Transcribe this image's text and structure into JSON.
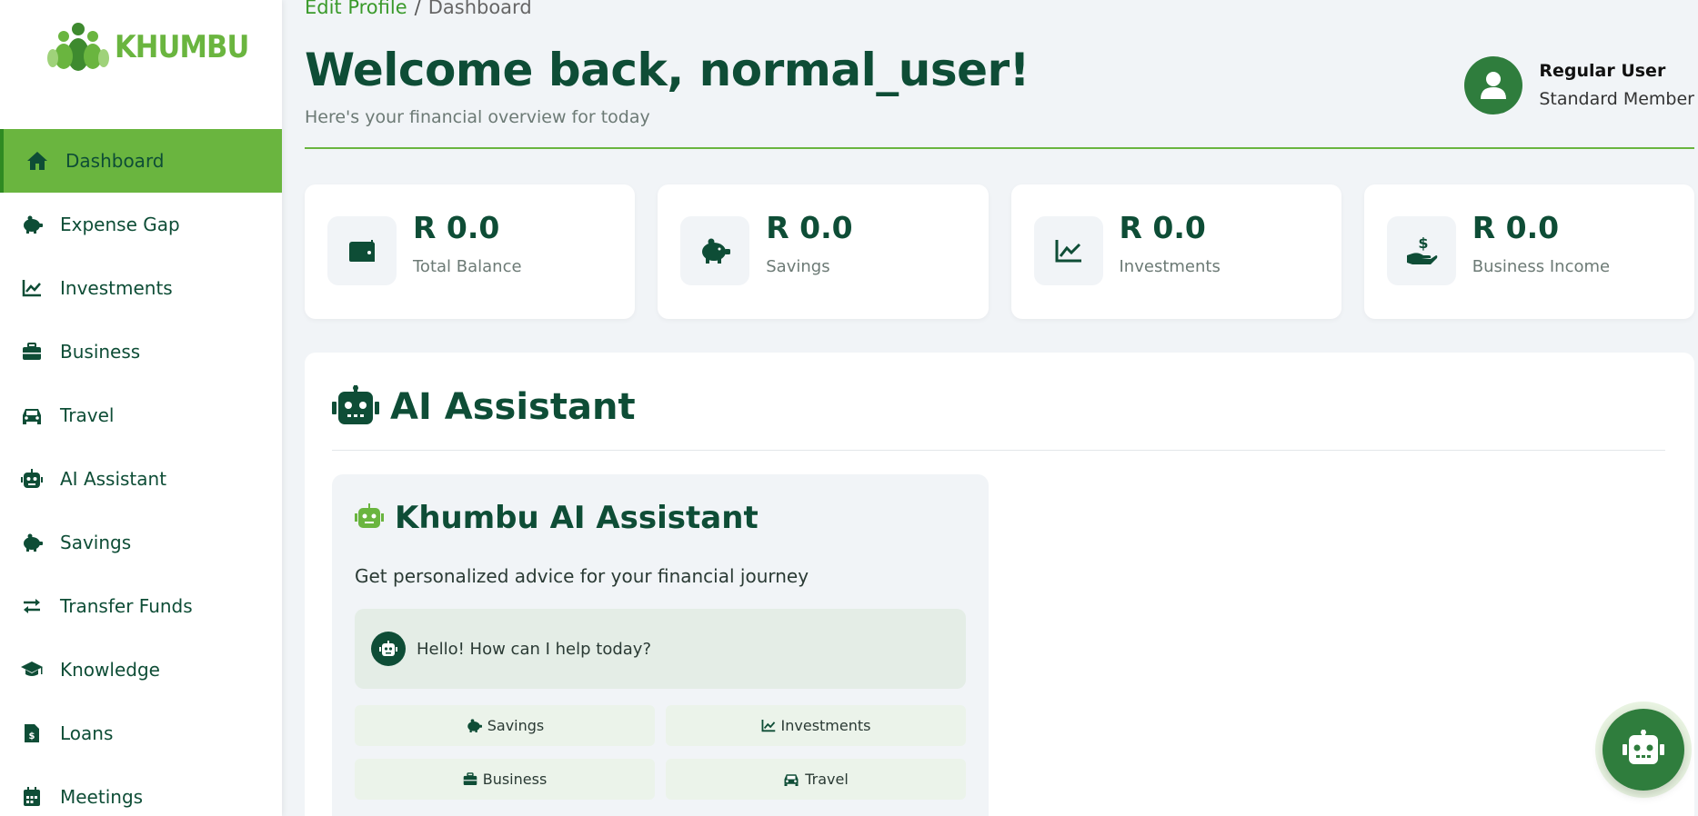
{
  "brand": {
    "name": "KHUMBU",
    "logo_icon": "khumbu-logo-icon",
    "accent": "#6ab53f",
    "dark": "#0e4d36"
  },
  "sidebar": {
    "items": [
      {
        "label": "Dashboard",
        "icon": "home-icon",
        "active": true
      },
      {
        "label": "Expense Gap",
        "icon": "piggy-bank-icon"
      },
      {
        "label": "Investments",
        "icon": "chart-line-icon"
      },
      {
        "label": "Business",
        "icon": "briefcase-icon"
      },
      {
        "label": "Travel",
        "icon": "car-icon"
      },
      {
        "label": "AI Assistant",
        "icon": "robot-icon"
      },
      {
        "label": "Savings",
        "icon": "piggy-bank-icon"
      },
      {
        "label": "Transfer Funds",
        "icon": "exchange-icon"
      },
      {
        "label": "Knowledge",
        "icon": "graduation-cap-icon"
      },
      {
        "label": "Loans",
        "icon": "invoice-dollar-icon"
      },
      {
        "label": "Meetings",
        "icon": "calendar-icon"
      }
    ]
  },
  "breadcrumb": {
    "link": "Edit Profile",
    "separator": "/",
    "current": "Dashboard"
  },
  "header": {
    "welcome": "Welcome back, normal_user!",
    "subtitle": "Here's your financial overview for today"
  },
  "user": {
    "name": "Regular User",
    "role": "Standard Member",
    "avatar_icon": "user-icon"
  },
  "stats": [
    {
      "value": "R 0.0",
      "label": "Total Balance",
      "icon": "wallet-icon"
    },
    {
      "value": "R 0.0",
      "label": "Savings",
      "icon": "piggy-bank-icon"
    },
    {
      "value": "R 0.0",
      "label": "Investments",
      "icon": "chart-line-icon"
    },
    {
      "value": "R 0.0",
      "label": "Business Income",
      "icon": "hand-dollar-icon"
    }
  ],
  "ai_section": {
    "title": "AI Assistant",
    "card_title": "Khumbu AI Assistant",
    "description": "Get personalized advice for your financial journey",
    "greeting": "Hello! How can I help today?",
    "quick_actions": [
      {
        "label": "Savings",
        "icon": "piggy-bank-icon"
      },
      {
        "label": "Investments",
        "icon": "chart-line-icon"
      },
      {
        "label": "Business",
        "icon": "briefcase-icon"
      },
      {
        "label": "Travel",
        "icon": "car-icon"
      }
    ]
  },
  "fab": {
    "icon": "robot-icon"
  }
}
